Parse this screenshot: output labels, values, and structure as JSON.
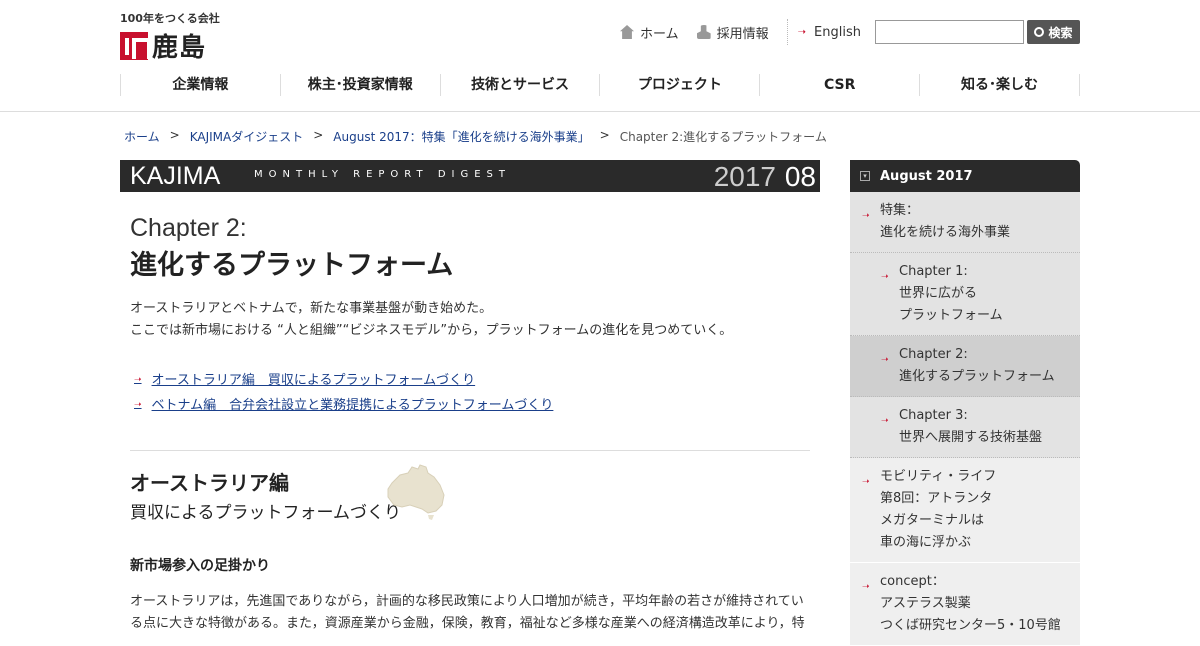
{
  "header": {
    "logo_tag": "100年をつくる会社",
    "logo_name": "鹿島",
    "util": {
      "home": "ホーム",
      "recruit": "採用情報",
      "english": "English",
      "search_button": "検索"
    },
    "gnav": [
      "企業情報",
      "株主･投資家情報",
      "技術とサービス",
      "プロジェクト",
      "CSR",
      "知る･楽しむ"
    ]
  },
  "breadcrumb": {
    "items": [
      "ホーム",
      "KAJIMAダイジェスト",
      "August 2017：特集「進化を続ける海外事業」"
    ],
    "current": "Chapter 2:進化するプラットフォーム"
  },
  "banner": {
    "logo": "KAJIMA",
    "subtitle": "MONTHLY REPORT DIGEST",
    "year": "2017",
    "month": "08"
  },
  "main": {
    "chapter_num": "Chapter 2:",
    "chapter_title": "進化するプラットフォーム",
    "lead_1": "オーストラリアとベトナムで，新たな事業基盤が動き始めた。",
    "lead_2": "ここでは新市場における “人と組織”“ビジネスモデル”から，プラットフォームの進化を見つめていく。",
    "links": [
      "オーストラリア編　買収によるプラットフォームづくり",
      "ベトナム編　合弁会社設立と業務提携によるプラットフォームづくり"
    ],
    "section_title": "オーストラリア編",
    "section_sub": "買収によるプラットフォームづくり",
    "sub_head": "新市場参入の足掛かり",
    "body_1": "オーストラリアは，先進国でありながら，計画的な移民政策により人口増加が続き，平均年齢の若さが維持されてい",
    "body_2": "る点に大きな特徴がある。また，資源産業から金融，保険，教育，福祉など多様な産業への経済構造改革により，特"
  },
  "sidebar": {
    "head": "August 2017",
    "items": [
      {
        "line1": "特集：",
        "line2": "進化を続ける海外事業"
      },
      {
        "line1": "Chapter 1:",
        "line2": "世界に広がる",
        "line3": "プラットフォーム"
      },
      {
        "line1": "Chapter 2:",
        "line2": "進化するプラットフォーム"
      },
      {
        "line1": "Chapter 3:",
        "line2": "世界へ展開する技術基盤"
      },
      {
        "line1": "モビリティ・ライフ",
        "line2": "第8回：アトランタ",
        "line3": "メガターミナルは",
        "line4": "車の海に浮かぶ"
      },
      {
        "line1": "concept：",
        "line2": "アステラス製薬",
        "line3": "つくば研究センター5・10号館"
      }
    ]
  },
  "colors": {
    "accent": "#c8102e",
    "banner_bg": "#2a2a2a",
    "link": "#1a3f8a"
  }
}
